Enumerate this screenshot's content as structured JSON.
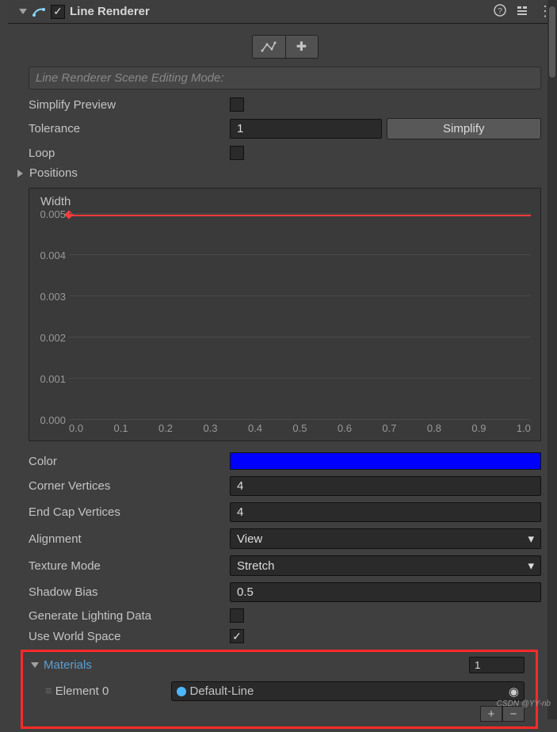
{
  "header": {
    "title": "Line Renderer",
    "enabled": true
  },
  "mode_label": "Line Renderer Scene Editing Mode:",
  "labels": {
    "simplify_preview": "Simplify Preview",
    "tolerance": "Tolerance",
    "loop": "Loop",
    "positions": "Positions",
    "width": "Width",
    "color": "Color",
    "corner_vertices": "Corner Vertices",
    "end_cap_vertices": "End Cap Vertices",
    "alignment": "Alignment",
    "texture_mode": "Texture Mode",
    "shadow_bias": "Shadow Bias",
    "generate_lighting": "Generate Lighting Data",
    "use_world_space": "Use World Space",
    "materials": "Materials",
    "element0": "Element 0"
  },
  "values": {
    "tolerance": "1",
    "simplify_btn": "Simplify",
    "color_hex": "#0000ff",
    "corner_vertices": "4",
    "end_cap_vertices": "4",
    "alignment": "View",
    "texture_mode": "Stretch",
    "shadow_bias": "0.5",
    "use_world_space": true,
    "materials_size": "1",
    "element0": "Default-Line"
  },
  "chart_data": {
    "type": "line",
    "title": "Width",
    "xlabel": "",
    "ylabel": "",
    "x": [
      0.0,
      1.0
    ],
    "values": [
      0.005,
      0.005
    ],
    "xlim": [
      0.0,
      1.0
    ],
    "ylim": [
      0.0,
      0.005
    ],
    "xticks": [
      "0.0",
      "0.1",
      "0.2",
      "0.3",
      "0.4",
      "0.5",
      "0.6",
      "0.7",
      "0.8",
      "0.9",
      "1.0"
    ],
    "yticks": [
      "0.000",
      "0.001",
      "0.002",
      "0.003",
      "0.004",
      "0.005"
    ]
  },
  "watermark": "CSDN @YY-nb"
}
